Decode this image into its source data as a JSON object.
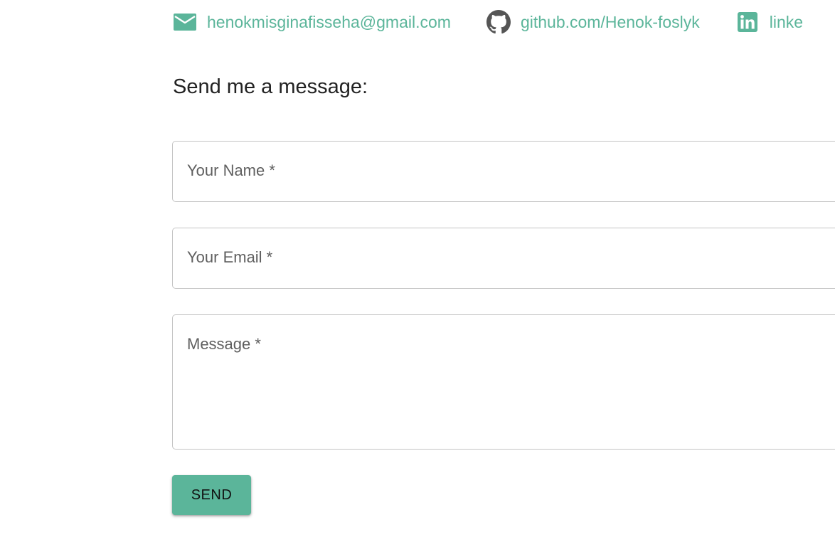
{
  "contacts": {
    "email": {
      "text": "henokmisginafisseha@gmail.com",
      "icon": "mail-icon"
    },
    "github": {
      "text": "github.com/Henok-foslyk",
      "icon": "github-icon"
    },
    "linkedin": {
      "text": "linke",
      "icon": "linkedin-icon"
    }
  },
  "form": {
    "title": "Send me a message:",
    "name_label": "Your Name *",
    "email_label": "Your Email *",
    "message_label": "Message *",
    "send_label": "SEND"
  },
  "colors": {
    "accent": "#5bb59a",
    "text": "#222222",
    "field_border": "#c4c4c4",
    "label": "#5f5f5f"
  }
}
